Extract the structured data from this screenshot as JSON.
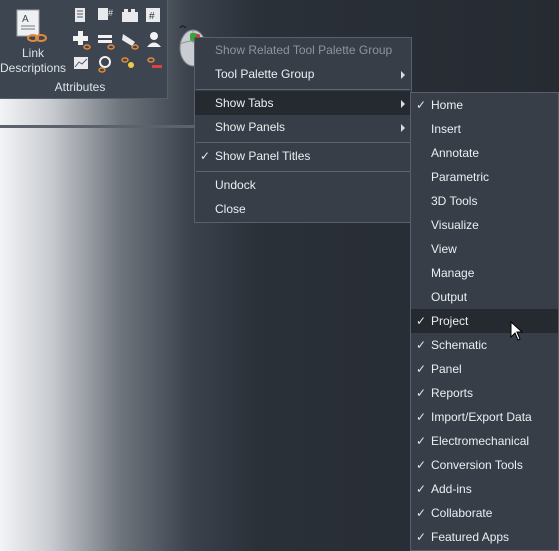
{
  "ribbon": {
    "link_label_1": "Link",
    "link_label_2": "Descriptions",
    "panel_title": "Attributes"
  },
  "context_menu": {
    "items": [
      {
        "label": "Show Related Tool Palette Group",
        "disabled": true
      },
      {
        "label": "Tool Palette Group",
        "submenu": true
      },
      {
        "label": "Show Tabs",
        "submenu": true,
        "highlighted": true
      },
      {
        "label": "Show Panels",
        "submenu": true
      },
      {
        "label": "Show Panel Titles",
        "checked": true
      },
      {
        "label": "Undock"
      },
      {
        "label": "Close"
      }
    ]
  },
  "tabs_menu": {
    "items": [
      {
        "label": "Home",
        "checked": true
      },
      {
        "label": "Insert",
        "checked": false
      },
      {
        "label": "Annotate",
        "checked": false
      },
      {
        "label": "Parametric",
        "checked": false
      },
      {
        "label": "3D Tools",
        "checked": false
      },
      {
        "label": "Visualize",
        "checked": false
      },
      {
        "label": "View",
        "checked": false
      },
      {
        "label": "Manage",
        "checked": false
      },
      {
        "label": "Output",
        "checked": false
      },
      {
        "label": "Project",
        "checked": true,
        "highlighted": true
      },
      {
        "label": "Schematic",
        "checked": true
      },
      {
        "label": "Panel",
        "checked": true
      },
      {
        "label": "Reports",
        "checked": true
      },
      {
        "label": "Import/Export Data",
        "checked": true
      },
      {
        "label": "Electromechanical",
        "checked": true
      },
      {
        "label": "Conversion Tools",
        "checked": true
      },
      {
        "label": "Add-ins",
        "checked": true
      },
      {
        "label": "Collaborate",
        "checked": true
      },
      {
        "label": "Featured Apps",
        "checked": true
      }
    ]
  },
  "colors": {
    "menu_bg": "#373e48",
    "highlight": "#252a31",
    "ribbon_bg": "#3d4550",
    "accent_orange": "#e08a3c"
  }
}
